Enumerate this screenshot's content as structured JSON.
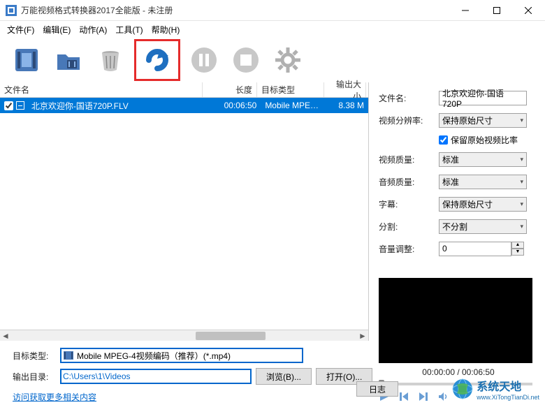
{
  "window": {
    "title": "万能视频格式转换器2017全能版 - 未注册"
  },
  "menu": {
    "file": "文件(F)",
    "edit": "编辑(E)",
    "action": "动作(A)",
    "tools": "工具(T)",
    "help": "帮助(H)"
  },
  "list": {
    "headers": {
      "name": "文件名",
      "length": "长度",
      "target": "目标类型",
      "size": "输出大小"
    },
    "rows": [
      {
        "name": "北京欢迎你-国语720P.FLV",
        "length": "00:06:50",
        "target": "Mobile MPEG-...",
        "size": "8.38 M",
        "checked": true
      }
    ]
  },
  "props": {
    "filename_label": "文件名:",
    "filename_value": "北京欢迎你-国语720P",
    "vres_label": "视频分辨率:",
    "vres_value": "保持原始尺寸",
    "keep_ratio": "保留原始视频比率",
    "vq_label": "视频质量:",
    "vq_value": "标准",
    "aq_label": "音频质量:",
    "aq_value": "标准",
    "sub_label": "字幕:",
    "sub_value": "保持原始尺寸",
    "split_label": "分割:",
    "split_value": "不分割",
    "vol_label": "音量调整:",
    "vol_value": "0"
  },
  "preview": {
    "time": "00:00:00 / 00:06:50"
  },
  "bottom": {
    "target_label": "目标类型:",
    "target_value": "Mobile MPEG-4视频编码（推荐）(*.mp4)",
    "outdir_label": "输出目录:",
    "outdir_value": "C:\\Users\\1\\Videos",
    "browse": "浏览(B)...",
    "open": "打开(O)...",
    "more_link": "访问获取更多相关内容",
    "log": "日志"
  },
  "brand": {
    "name": "系统天地",
    "url": "www.XiTongTianDi.net"
  }
}
